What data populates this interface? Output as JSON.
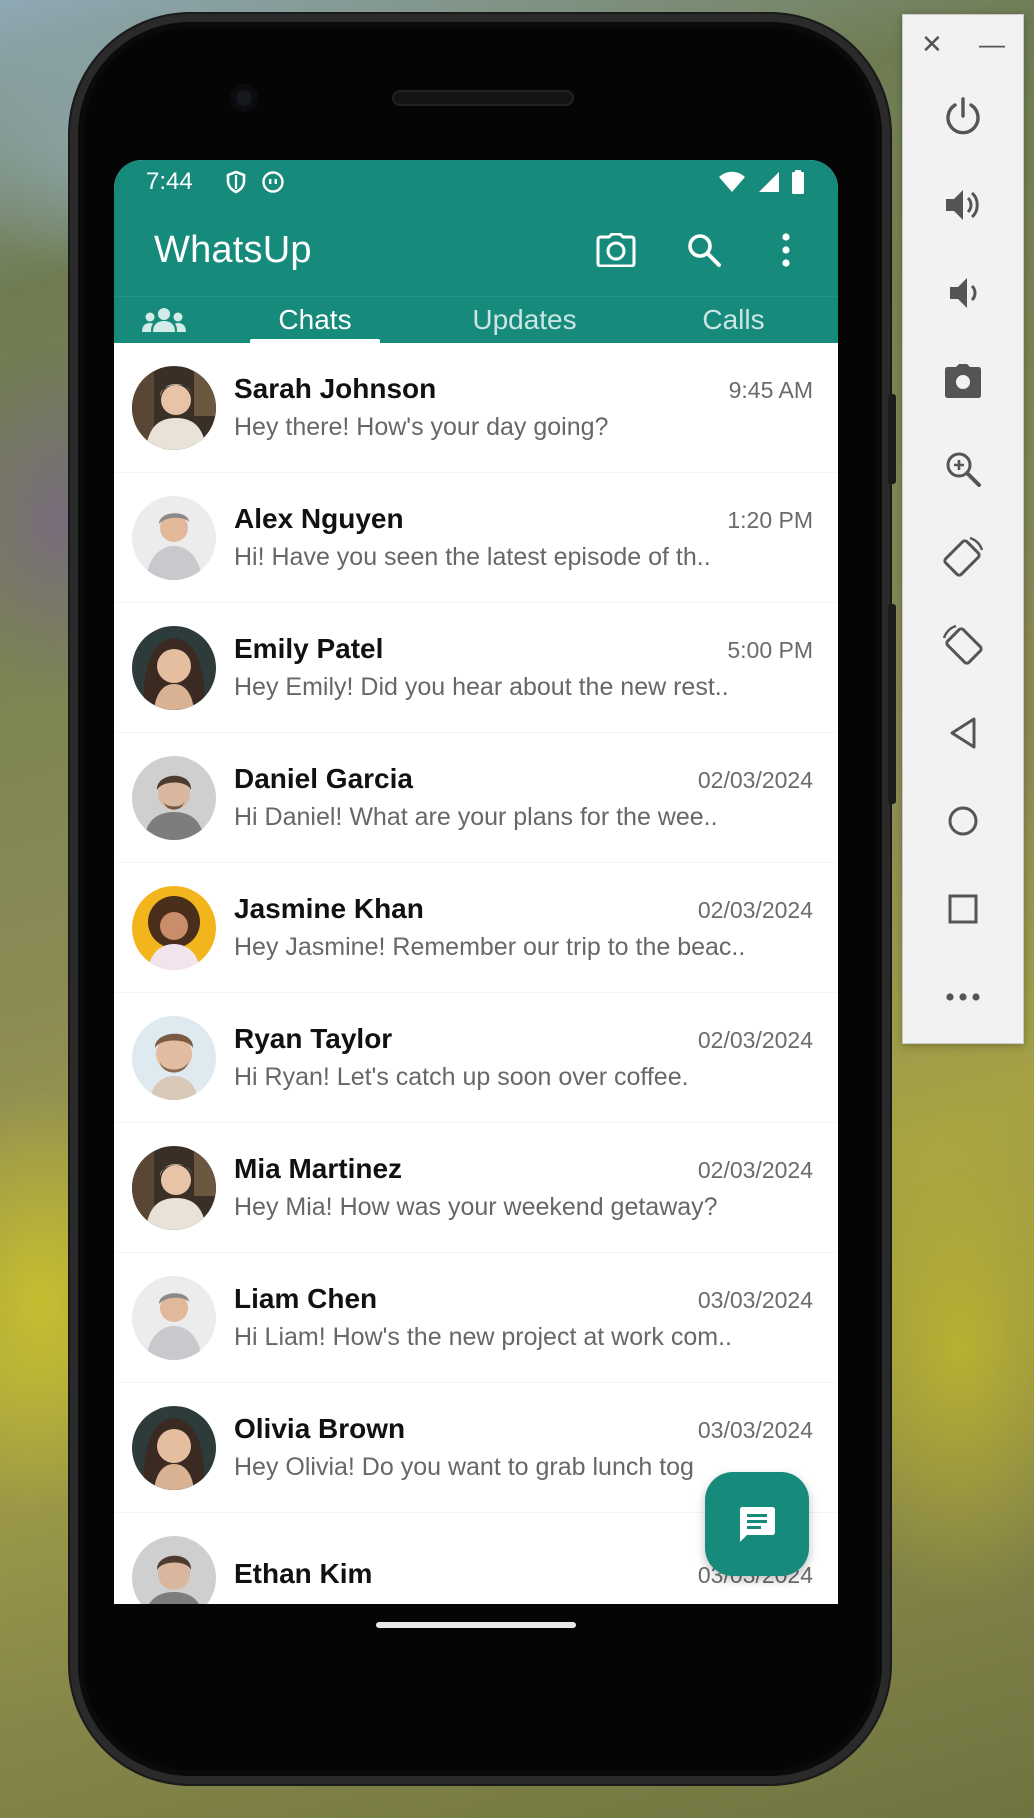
{
  "status_bar": {
    "time": "7:44"
  },
  "app": {
    "title": "WhatsUp",
    "brand_color": "#168a7b",
    "toolbar_icons": [
      "camera-icon",
      "search-icon",
      "more-vert-icon"
    ]
  },
  "tabs": {
    "community_icon": "community-icon",
    "items": [
      {
        "label": "Chats",
        "active": true
      },
      {
        "label": "Updates",
        "active": false
      },
      {
        "label": "Calls",
        "active": false
      }
    ]
  },
  "chats": [
    {
      "name": "Sarah Johnson",
      "time": "9:45 AM",
      "message": "Hey there! How's your day going?"
    },
    {
      "name": "Alex Nguyen",
      "time": "1:20 PM",
      "message": "Hi! Have you seen the latest episode of th.."
    },
    {
      "name": "Emily Patel",
      "time": "5:00 PM",
      "message": "Hey Emily! Did you hear about the new rest.."
    },
    {
      "name": "Daniel Garcia",
      "time": "02/03/2024",
      "message": "Hi Daniel! What are your plans for the wee.."
    },
    {
      "name": "Jasmine Khan",
      "time": "02/03/2024",
      "message": "Hey Jasmine! Remember our trip to the beac.."
    },
    {
      "name": "Ryan Taylor",
      "time": "02/03/2024",
      "message": "Hi Ryan! Let's catch up soon over coffee."
    },
    {
      "name": "Mia Martinez",
      "time": "02/03/2024",
      "message": "Hey Mia! How was your weekend getaway?"
    },
    {
      "name": "Liam Chen",
      "time": "03/03/2024",
      "message": "Hi Liam! How's the new project at work com.."
    },
    {
      "name": "Olivia Brown",
      "time": "03/03/2024",
      "message": "Hey Olivia! Do you want to grab lunch tog"
    },
    {
      "name": "Ethan Kim",
      "time": "03/03/2024",
      "message": ""
    }
  ],
  "fab": {
    "icon": "new-chat-icon"
  },
  "emulator_panel": {
    "window_controls": [
      "close-icon",
      "minimize-icon"
    ],
    "buttons": [
      "power-icon",
      "volume-up-icon",
      "volume-down-icon",
      "camera-icon",
      "zoom-icon",
      "rotate-left-icon",
      "rotate-right-icon",
      "back-icon",
      "home-icon",
      "overview-icon",
      "more-icon"
    ]
  }
}
